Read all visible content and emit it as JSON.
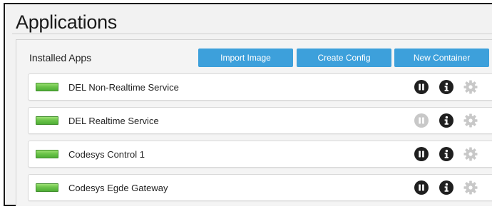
{
  "header": {
    "title": "Applications"
  },
  "panel": {
    "title": "Installed Apps",
    "buttons": {
      "import": "Import Image",
      "config": "Create Config",
      "container": "New Container"
    }
  },
  "apps": [
    {
      "name": "DEL Non-Realtime Service",
      "status": "running",
      "pause_enabled": true
    },
    {
      "name": "DEL Realtime Service",
      "status": "running",
      "pause_enabled": false
    },
    {
      "name": "Codesys Control 1",
      "status": "running",
      "pause_enabled": true
    },
    {
      "name": "Codesys Egde Gateway",
      "status": "running",
      "pause_enabled": true
    }
  ],
  "icons": {
    "status": "status-led-icon",
    "pause": "pause-icon",
    "info": "info-icon",
    "settings": "gear-icon"
  },
  "colors": {
    "accent": "#3da0db",
    "status_green": "#6cc44a",
    "icon_dark": "#1f1f1f",
    "icon_disabled": "#c8c8c8"
  }
}
